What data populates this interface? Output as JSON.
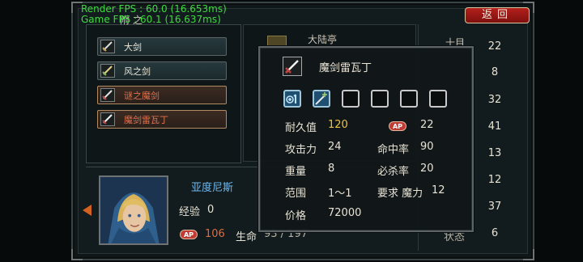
{
  "overlay": {
    "render_fps": "Render FPS : 60.0 (16.653ms)",
    "game_fps": "Game FPS : 60.1 (16.637ms)"
  },
  "header": {
    "back_label": "返回",
    "tab_partial": "附 之"
  },
  "weapons": [
    {
      "name": "大剑",
      "color": "#ece6d8",
      "selected": false
    },
    {
      "name": "风之剑",
      "color": "#ece6d8",
      "selected": false
    },
    {
      "name": "谜之魔剑",
      "color": "#e2704c",
      "selected": true
    },
    {
      "name": "魔剑雷瓦丁",
      "color": "#e2704c",
      "selected": true
    }
  ],
  "background_list": {
    "top_text_left": "大陆亭",
    "top_text_right": "十目",
    "values": [
      "22",
      "8",
      "32",
      "41",
      "13",
      "12",
      "37",
      "6"
    ]
  },
  "character": {
    "name": "亚度尼斯",
    "exp_label": "经验",
    "exp_value": "0",
    "ap_badge": "AP",
    "ap_value": "106",
    "hp_label": "生命",
    "hp_value": "93 / 197",
    "right_label": "状态"
  },
  "popup": {
    "item_name": "魔剑雷瓦丁",
    "slots": [
      "skill-plus1-icon",
      "sword-plus-icon",
      "empty-slot",
      "empty-slot",
      "empty-slot",
      "empty-slot"
    ],
    "stats": {
      "durability_label": "耐久值",
      "durability_value": "120",
      "ap_badge": "AP",
      "ap_value": "22",
      "attack_label": "攻击力",
      "attack_value": "24",
      "hit_label": "命中率",
      "hit_value": "90",
      "weight_label": "重量",
      "weight_value": "8",
      "crit_label": "必杀率",
      "crit_value": "20",
      "range_label": "范围",
      "range_value": "1～1",
      "req_label": "要求 魔力",
      "req_value": "12",
      "price_label": "价格",
      "price_value": "72000"
    }
  },
  "colors": {
    "accent_red": "#b3201c",
    "gold_value": "#f0c33e",
    "name_blue": "#6fb7ea",
    "fps_green": "#3ddc3d"
  }
}
